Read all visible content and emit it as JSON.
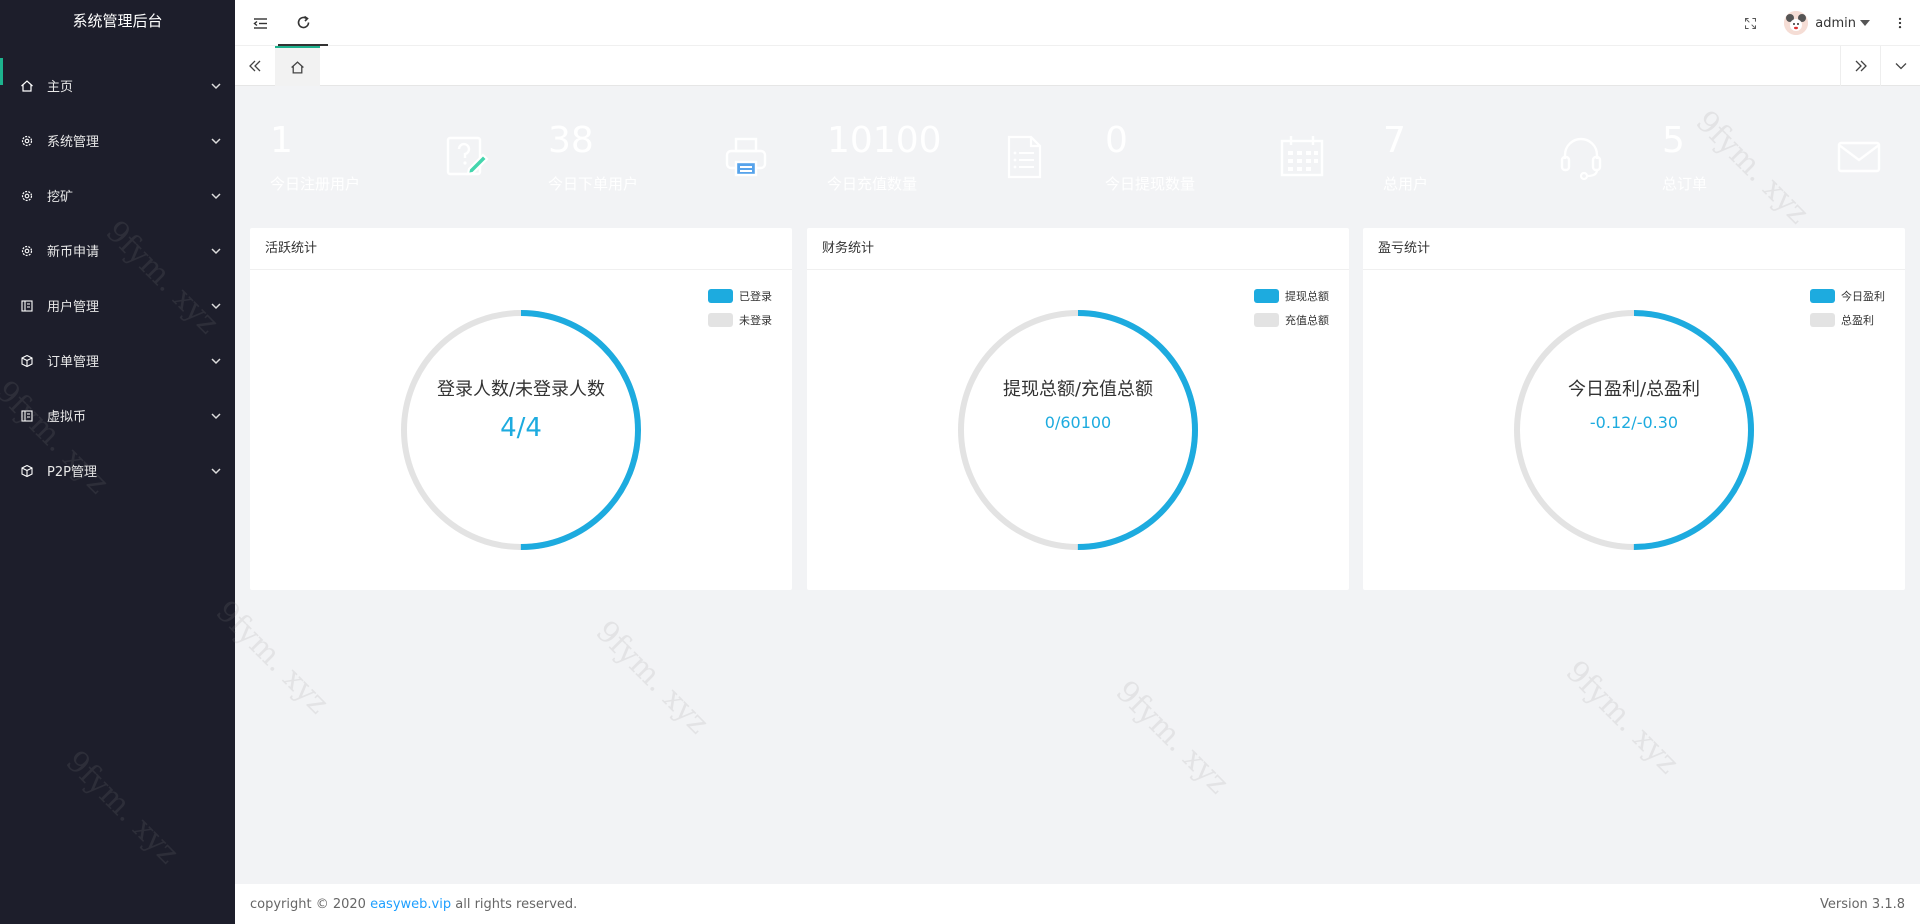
{
  "app": {
    "title": "系统管理后台"
  },
  "sidebar": {
    "items": [
      {
        "label": "主页",
        "icon": "home-icon"
      },
      {
        "label": "系统管理",
        "icon": "gear-icon"
      },
      {
        "label": "挖矿",
        "icon": "gear-icon"
      },
      {
        "label": "新币申请",
        "icon": "gear-icon"
      },
      {
        "label": "用户管理",
        "icon": "user-book-icon"
      },
      {
        "label": "订单管理",
        "icon": "cube-icon"
      },
      {
        "label": "虚拟币",
        "icon": "book-icon"
      },
      {
        "label": "P2P管理",
        "icon": "cube-icon"
      }
    ]
  },
  "header": {
    "username": "admin"
  },
  "stats": [
    {
      "value": "1",
      "label": "今日注册用户",
      "color": "#44d5ad",
      "icon": "question-edit-icon"
    },
    {
      "value": "38",
      "label": "今日下单用户",
      "color": "#57a3eb",
      "icon": "printer-icon"
    },
    {
      "value": "10100",
      "label": "今日充值数量",
      "color": "#9aaefc",
      "icon": "document-list-icon"
    },
    {
      "value": "0",
      "label": "今日提现数量",
      "color": "#f48fa2",
      "icon": "calendar-icon"
    },
    {
      "value": "7",
      "label": "总用户",
      "color": "#fdab4b",
      "icon": "headset-icon"
    },
    {
      "value": "5",
      "label": "总订单",
      "color": "#9ac536",
      "icon": "mail-icon"
    }
  ],
  "panels": [
    {
      "title": "活跃统计",
      "legend": [
        "已登录",
        "未登录"
      ],
      "ring_title": "登录人数/未登录人数",
      "ring_value": "4/4",
      "ratio": 0.5
    },
    {
      "title": "财务统计",
      "legend": [
        "提现总额",
        "充值总额"
      ],
      "ring_title": "提现总额/充值总额",
      "ring_value": "0/60100",
      "ratio": 0.5
    },
    {
      "title": "盈亏统计",
      "legend": [
        "今日盈利",
        "总盈利"
      ],
      "ring_title": "今日盈利/总盈利",
      "ring_value": "-0.12/-0.30",
      "ratio": 0.5
    }
  ],
  "colors": {
    "accent": "#1dabdf",
    "ring_bg": "#e3e3e3",
    "sidebar_bg": "#1d1e2b",
    "active_bar": "#1db38e"
  },
  "footer": {
    "copyright_prefix": "copyright © 2020",
    "link": "easyweb.vip",
    "suffix": "all rights reserved.",
    "version": "Version 3.1.8"
  },
  "watermark": "9fym. xyz"
}
